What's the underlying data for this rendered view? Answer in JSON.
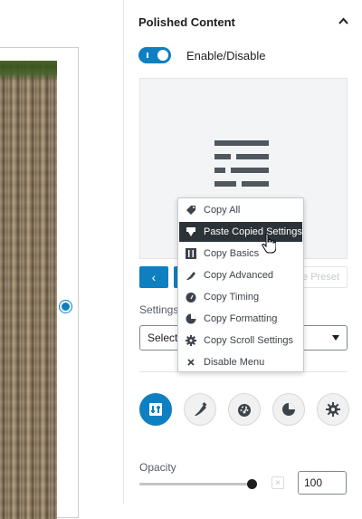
{
  "panel": {
    "title": "Polished Content",
    "toggle_label": "Enable/Disable",
    "toggle_on": true
  },
  "presets": {
    "prev_label": "‹",
    "save_label": "e Preset"
  },
  "settings": {
    "label": "Settings",
    "select_value": "Select"
  },
  "context_menu": {
    "items": [
      {
        "label": "Copy All",
        "icon": "copy-all-icon"
      },
      {
        "label": "Paste Copied Settings",
        "icon": "paste-icon",
        "highlighted": true
      },
      {
        "label": "Copy Basics",
        "icon": "basics-icon"
      },
      {
        "label": "Copy Advanced",
        "icon": "advanced-icon"
      },
      {
        "label": "Copy Timing",
        "icon": "timing-icon"
      },
      {
        "label": "Copy Formatting",
        "icon": "formatting-icon"
      },
      {
        "label": "Copy Scroll Settings",
        "icon": "gear-icon"
      },
      {
        "label": "Disable Menu",
        "icon": "close-icon"
      }
    ]
  },
  "tabs": [
    {
      "name": "basics-tab",
      "icon": "basics-icon",
      "active": true
    },
    {
      "name": "advanced-tab",
      "icon": "advanced-icon",
      "active": false
    },
    {
      "name": "timing-tab",
      "icon": "timing-icon",
      "active": false
    },
    {
      "name": "formatting-tab",
      "icon": "formatting-icon",
      "active": false
    },
    {
      "name": "scroll-settings-tab",
      "icon": "gear-icon",
      "active": false
    }
  ],
  "opacity": {
    "label": "Opacity",
    "value": "100",
    "level": 1.0,
    "reset_label": "×"
  },
  "colors": {
    "accent": "#0e7fc1",
    "menu_highlight": "#2c3338"
  }
}
